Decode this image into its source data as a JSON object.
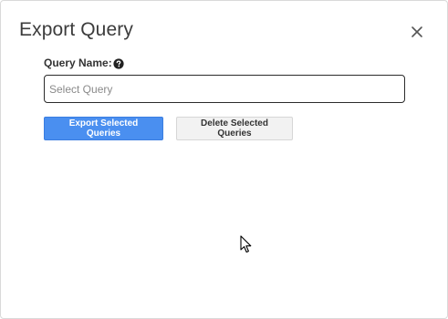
{
  "dialog": {
    "title": "Export Query",
    "close_icon": "close-icon"
  },
  "form": {
    "query_name_label": "Query Name:",
    "help_icon": "question-circle-icon",
    "query_input": {
      "value": "",
      "placeholder": "Select Query"
    }
  },
  "actions": {
    "export_label": "Export Selected Queries",
    "delete_label": "Delete Selected Queries"
  },
  "colors": {
    "primary": "#4a8ff0",
    "secondary_bg": "#f2f2f2",
    "title_text": "#3c3c3c"
  }
}
